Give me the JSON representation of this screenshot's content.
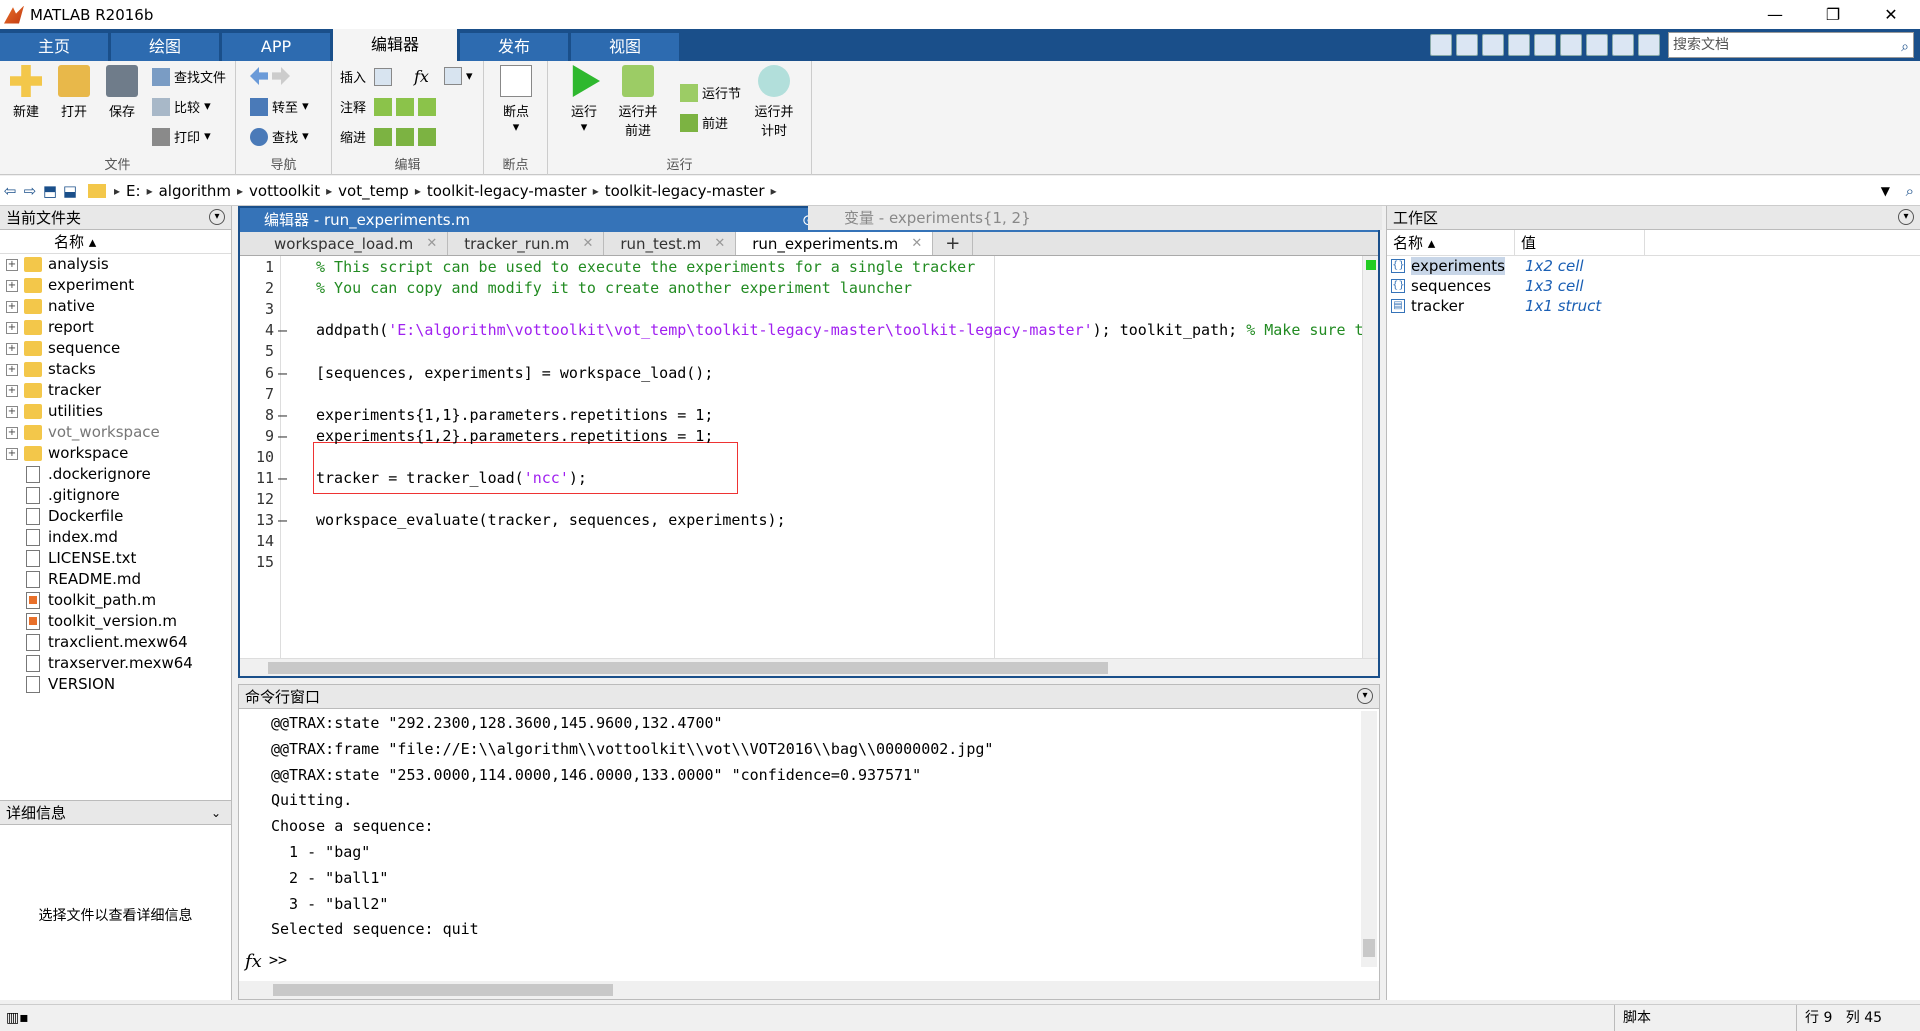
{
  "window": {
    "title": "MATLAB R2016b"
  },
  "tabs": [
    "主页",
    "绘图",
    "APP",
    "编辑器",
    "发布",
    "视图"
  ],
  "search": {
    "placeholder": "搜索文档"
  },
  "ribbon": {
    "file": {
      "title": "文件",
      "new": "新建",
      "open": "打开",
      "save": "保存",
      "find_files": "查找文件",
      "compare": "比较",
      "print": "打印"
    },
    "navigate": {
      "title": "导航",
      "goto": "转至",
      "find": "查找"
    },
    "edit": {
      "title": "编辑",
      "insert": "插入",
      "comment": "注释",
      "indent": "缩进",
      "fx": "fx"
    },
    "breakpoints": {
      "title": "断点",
      "label": "断点"
    },
    "run": {
      "title": "运行",
      "run": "运行",
      "run_advance": "运行并\n前进",
      "run_section": "运行节",
      "advance": "前进",
      "run_time": "运行并\n计时"
    }
  },
  "path": [
    "E:",
    "algorithm",
    "vottoolkit",
    "vot_temp",
    "toolkit-legacy-master",
    "toolkit-legacy-master"
  ],
  "current_folder": {
    "title": "当前文件夹",
    "col_name": "名称",
    "items": [
      {
        "name": "analysis",
        "type": "folder"
      },
      {
        "name": "experiment",
        "type": "folder"
      },
      {
        "name": "native",
        "type": "folder"
      },
      {
        "name": "report",
        "type": "folder"
      },
      {
        "name": "sequence",
        "type": "folder"
      },
      {
        "name": "stacks",
        "type": "folder"
      },
      {
        "name": "tracker",
        "type": "folder"
      },
      {
        "name": "utilities",
        "type": "folder"
      },
      {
        "name": "vot_workspace",
        "type": "folder",
        "muted": true
      },
      {
        "name": "workspace",
        "type": "folder"
      },
      {
        "name": ".dockerignore",
        "type": "file"
      },
      {
        "name": ".gitignore",
        "type": "file"
      },
      {
        "name": "Dockerfile",
        "type": "file"
      },
      {
        "name": "index.md",
        "type": "file"
      },
      {
        "name": "LICENSE.txt",
        "type": "file"
      },
      {
        "name": "README.md",
        "type": "file"
      },
      {
        "name": "toolkit_path.m",
        "type": "mfile"
      },
      {
        "name": "toolkit_version.m",
        "type": "mfile"
      },
      {
        "name": "traxclient.mexw64",
        "type": "file"
      },
      {
        "name": "traxserver.mexw64",
        "type": "file"
      },
      {
        "name": "VERSION",
        "type": "file"
      }
    ]
  },
  "details": {
    "title": "详细信息",
    "message": "选择文件以查看详细信息"
  },
  "editor": {
    "title": "编辑器 - run_experiments.m",
    "variable_tab": "变量 - experiments{1, 2}",
    "files": [
      "workspace_load.m",
      "tracker_run.m",
      "run_test.m",
      "run_experiments.m"
    ],
    "lines": [
      {
        "n": "1",
        "dash": "",
        "code": "% This script can be used to execute the experiments for a single tracker",
        "cls": "cm"
      },
      {
        "n": "2",
        "dash": "",
        "code": "% You can copy and modify it to create another experiment launcher",
        "cls": "cm"
      },
      {
        "n": "3",
        "dash": "",
        "code": "",
        "cls": ""
      },
      {
        "n": "4",
        "dash": "—",
        "code": "addpath('E:\\algorithm\\vottoolkit\\vot_temp\\toolkit-legacy-master\\toolkit-legacy-master'); toolkit_path; % Make sure t",
        "cls": "mix"
      },
      {
        "n": "5",
        "dash": "",
        "code": "",
        "cls": ""
      },
      {
        "n": "6",
        "dash": "—",
        "code": "[sequences, experiments] = workspace_load();",
        "cls": ""
      },
      {
        "n": "7",
        "dash": "",
        "code": "",
        "cls": ""
      },
      {
        "n": "8",
        "dash": "—",
        "code": "experiments{1,1}.parameters.repetitions = 1;",
        "cls": ""
      },
      {
        "n": "9",
        "dash": "—",
        "code": "experiments{1,2}.parameters.repetitions = 1;",
        "cls": ""
      },
      {
        "n": "10",
        "dash": "",
        "code": "",
        "cls": ""
      },
      {
        "n": "11",
        "dash": "—",
        "code": "tracker = tracker_load('ncc');",
        "cls": "mix2"
      },
      {
        "n": "12",
        "dash": "",
        "code": "",
        "cls": ""
      },
      {
        "n": "13",
        "dash": "—",
        "code": "workspace_evaluate(tracker, sequences, experiments);",
        "cls": ""
      },
      {
        "n": "14",
        "dash": "",
        "code": "",
        "cls": ""
      },
      {
        "n": "15",
        "dash": "",
        "code": "",
        "cls": ""
      }
    ]
  },
  "command_window": {
    "title": "命令行窗口",
    "lines": [
      "@@TRAX:state \"292.2300,128.3600,145.9600,132.4700\"",
      "@@TRAX:frame \"file://E:\\\\algorithm\\\\vottoolkit\\\\vot\\\\VOT2016\\\\bag\\\\00000002.jpg\"",
      "@@TRAX:state \"253.0000,114.0000,146.0000,133.0000\" \"confidence=0.937571\"",
      "Quitting.",
      "Choose a sequence:",
      "  1 - \"bag\"",
      "  2 - \"ball1\"",
      "  3 - \"ball2\"",
      "Selected sequence: quit"
    ],
    "prompt": ">>",
    "fx": "fx"
  },
  "workspace": {
    "title": "工作区",
    "col_name": "名称",
    "col_value": "值",
    "vars": [
      {
        "name": "experiments",
        "value": "1x2 cell",
        "icon": "{}"
      },
      {
        "name": "sequences",
        "value": "1x3 cell",
        "icon": "{}"
      },
      {
        "name": "tracker",
        "value": "1x1 struct",
        "icon": "▤"
      }
    ]
  },
  "status": {
    "mode": "脚本",
    "row_label": "行",
    "row": "9",
    "col_label": "列",
    "col": "45"
  }
}
